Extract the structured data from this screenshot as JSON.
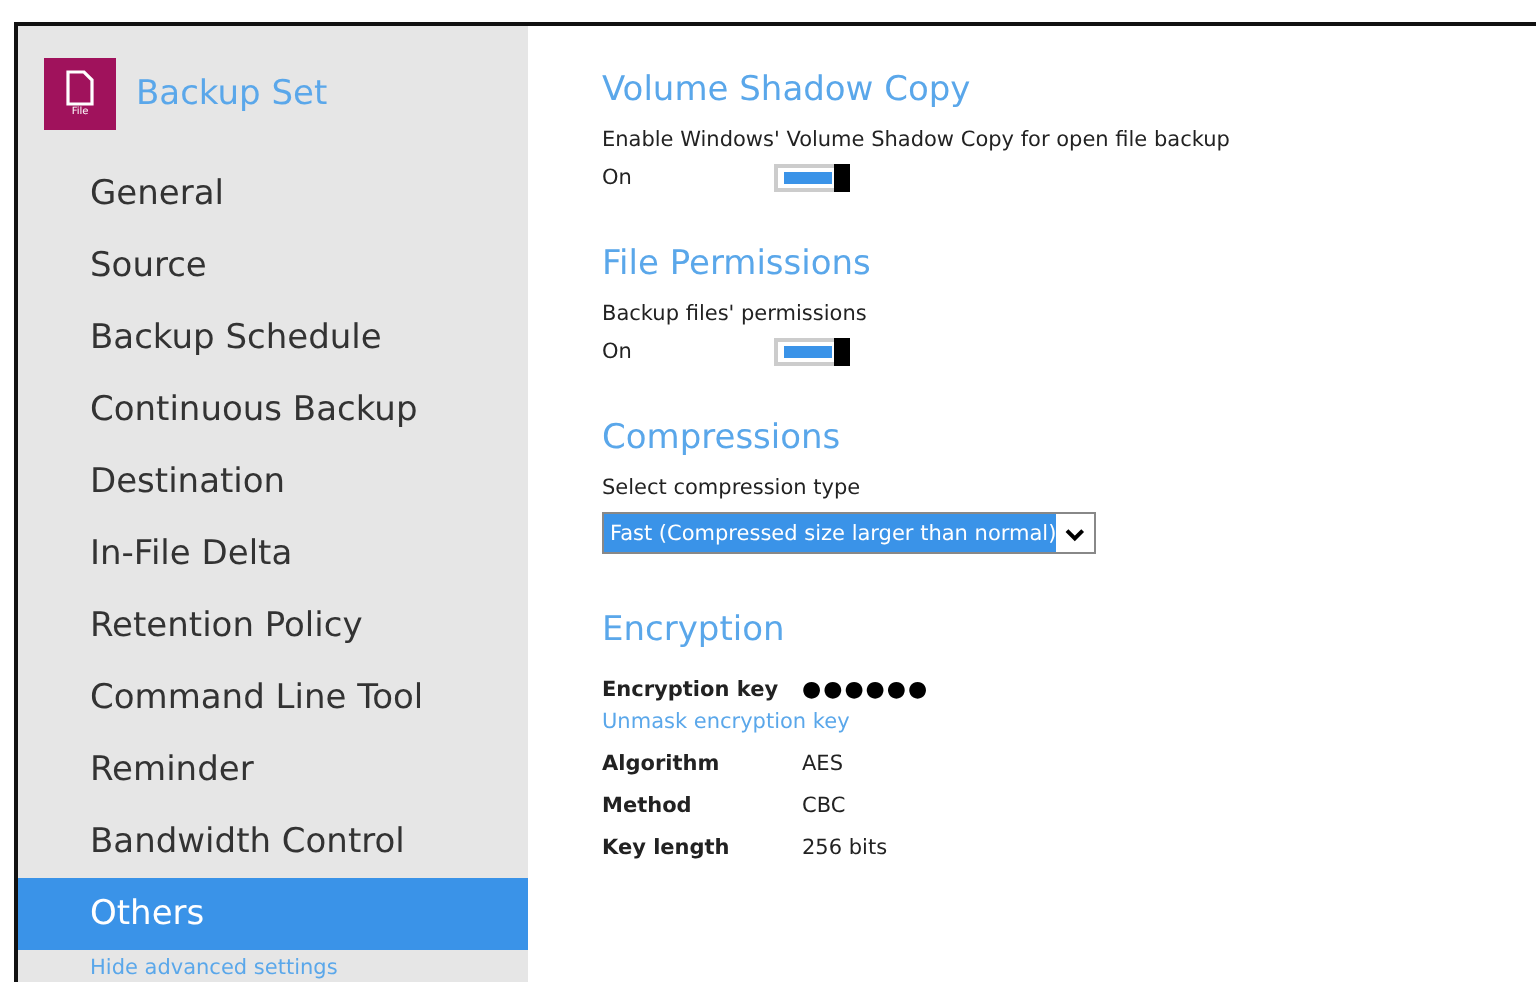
{
  "sidebar": {
    "title": "Backup Set",
    "icon_label": "File",
    "items": [
      {
        "label": "General",
        "selected": false
      },
      {
        "label": "Source",
        "selected": false
      },
      {
        "label": "Backup Schedule",
        "selected": false
      },
      {
        "label": "Continuous Backup",
        "selected": false
      },
      {
        "label": "Destination",
        "selected": false
      },
      {
        "label": "In-File Delta",
        "selected": false
      },
      {
        "label": "Retention Policy",
        "selected": false
      },
      {
        "label": "Command Line Tool",
        "selected": false
      },
      {
        "label": "Reminder",
        "selected": false
      },
      {
        "label": "Bandwidth Control",
        "selected": false
      },
      {
        "label": "Others",
        "selected": true
      }
    ],
    "footer_link": "Hide advanced settings"
  },
  "sections": [
    {
      "title": "Volume Shadow Copy",
      "label": "Enable Windows' Volume Shadow Copy for open file backup",
      "state_text": "On",
      "on": true
    },
    {
      "title": "File Permissions",
      "label": "Backup files' permissions",
      "state_text": "On",
      "on": true
    }
  ],
  "compressions": {
    "title": "Compressions",
    "label": "Select compression type",
    "value": "Fast (Compressed size larger than normal)"
  },
  "encryption": {
    "title": "Encryption",
    "key_label": "Encryption key",
    "key_value": "●●●●●●",
    "unmask_link": "Unmask encryption key",
    "rows": [
      {
        "label": "Algorithm",
        "value": "AES"
      },
      {
        "label": "Method",
        "value": "CBC"
      },
      {
        "label": "Key length",
        "value": "256 bits"
      }
    ]
  }
}
